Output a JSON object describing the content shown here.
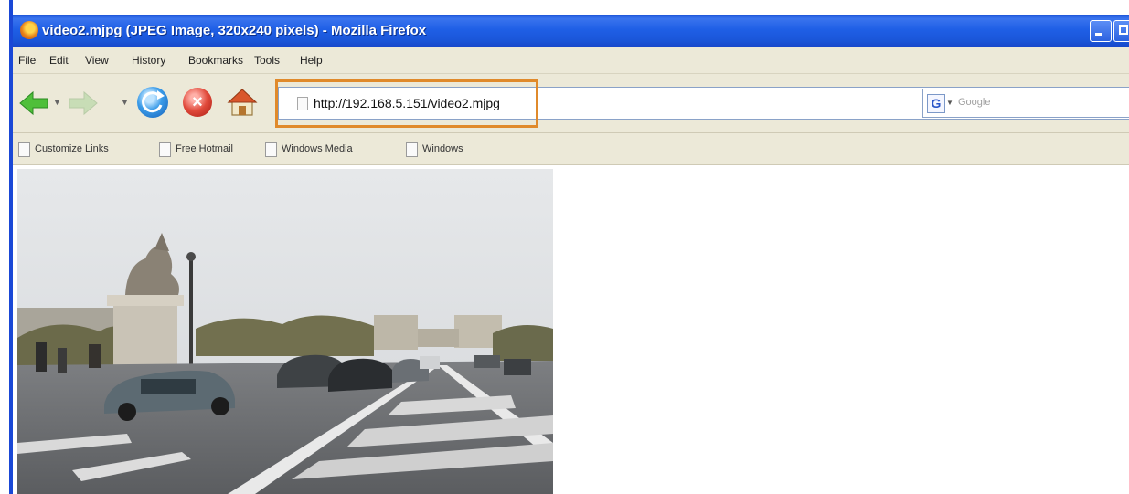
{
  "window": {
    "title": "video2.mjpg (JPEG Image, 320x240 pixels) - Mozilla Firefox",
    "accent_color": "#1f5fe6"
  },
  "menu": {
    "items": [
      "File",
      "Edit",
      "View",
      "History",
      "Bookmarks",
      "Tools",
      "Help"
    ]
  },
  "navigation": {
    "url": "http://192.168.5.151/video2.mjpg",
    "highlight_color": "#e08a2b",
    "search_placeholder": "Google",
    "search_engine_icon": "G"
  },
  "bookmarks": {
    "items": [
      "Customize Links",
      "Free Hotmail",
      "Windows Media",
      "Windows"
    ]
  },
  "content": {
    "image_alt": "street scene with statue and traffic"
  }
}
